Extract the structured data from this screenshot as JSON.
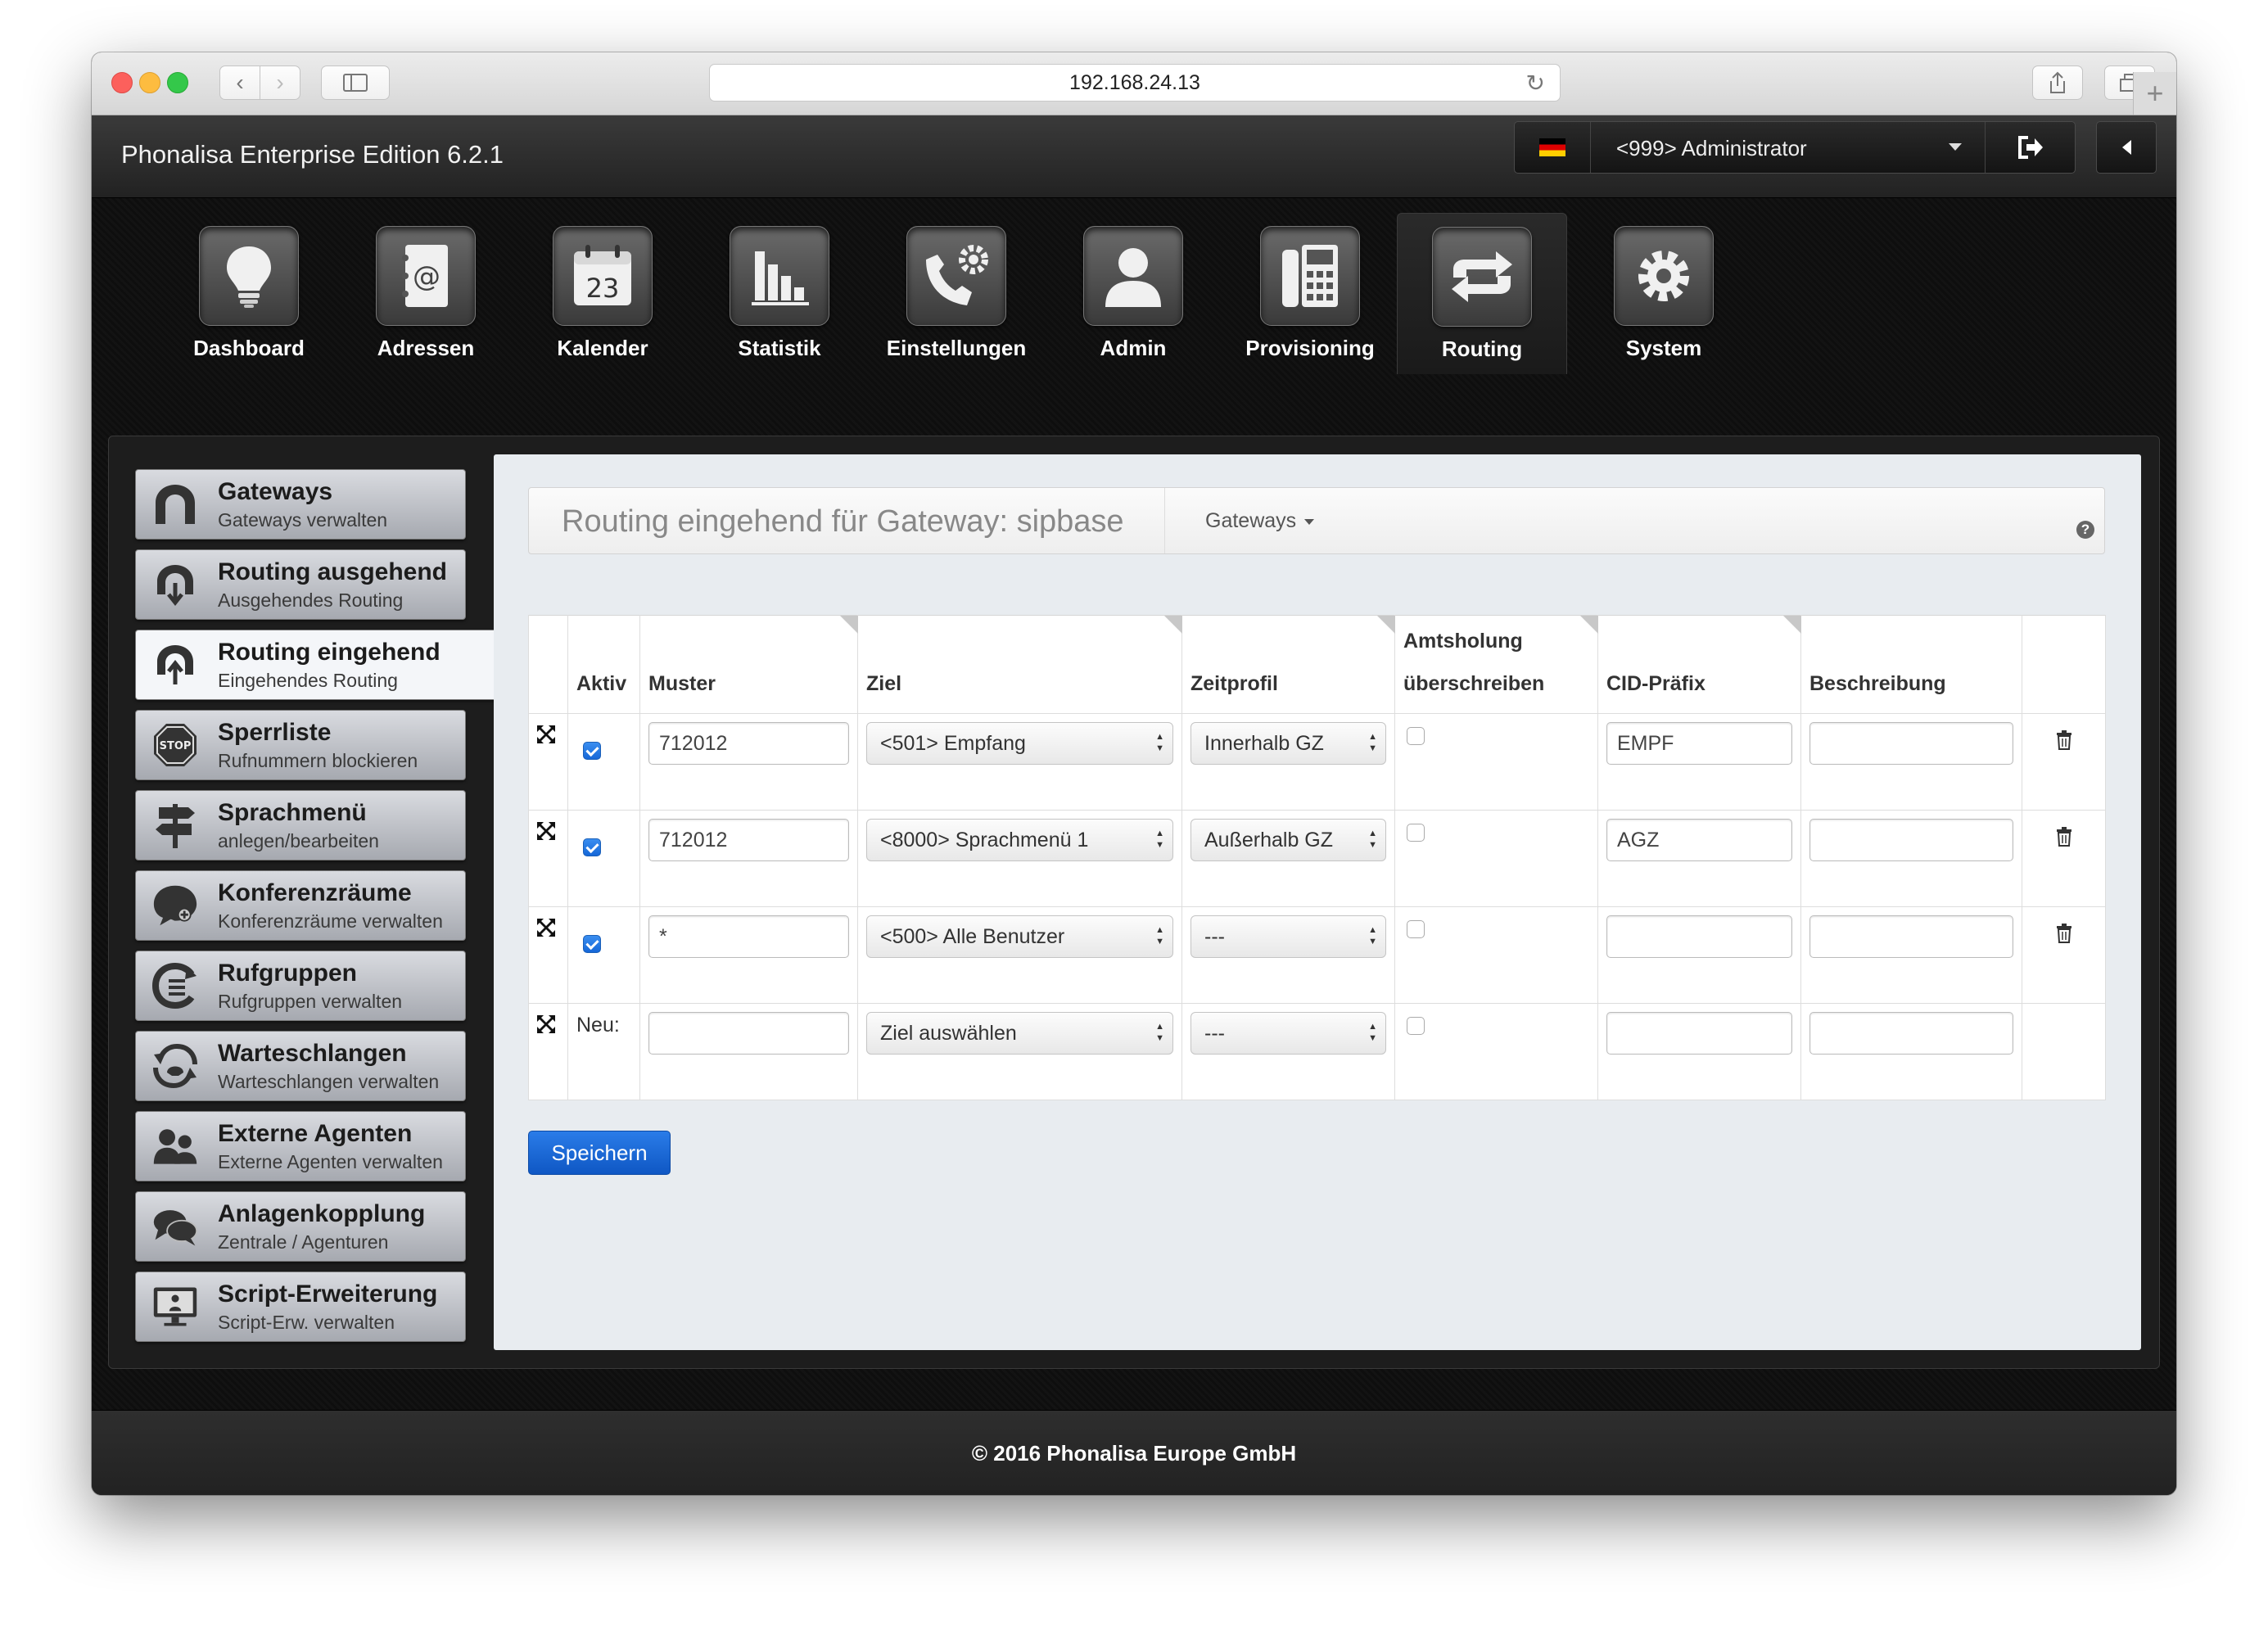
{
  "browser": {
    "url": "192.168.24.13"
  },
  "app": {
    "title": "Phonalisa Enterprise Edition 6.2.1",
    "user": "<999> Administrator",
    "footer": "© 2016 Phonalisa Europe GmbH"
  },
  "nav": [
    {
      "label": "Dashboard",
      "icon": "lightbulb-icon"
    },
    {
      "label": "Adressen",
      "icon": "address-book-icon"
    },
    {
      "label": "Kalender",
      "icon": "calendar-icon",
      "day": "23"
    },
    {
      "label": "Statistik",
      "icon": "bar-chart-icon"
    },
    {
      "label": "Einstellungen",
      "icon": "phone-settings-icon"
    },
    {
      "label": "Admin",
      "icon": "user-icon"
    },
    {
      "label": "Provisioning",
      "icon": "desk-phone-icon"
    },
    {
      "label": "Routing",
      "icon": "routing-arrows-icon",
      "active": true
    },
    {
      "label": "System",
      "icon": "gear-icon"
    }
  ],
  "sidebar": [
    {
      "title": "Gateways",
      "sub": "Gateways verwalten",
      "icon": "gateway-icon"
    },
    {
      "title": "Routing ausgehend",
      "sub": "Ausgehendes Routing",
      "icon": "gateway-out-icon"
    },
    {
      "title": "Routing eingehend",
      "sub": "Eingehendes Routing",
      "icon": "gateway-in-icon",
      "active": true
    },
    {
      "title": "Sperrliste",
      "sub": "Rufnummern blockieren",
      "icon": "stop-sign-icon",
      "icon_text": "STOP"
    },
    {
      "title": "Sprachmenü",
      "sub": "anlegen/bearbeiten",
      "icon": "signpost-icon"
    },
    {
      "title": "Konferenzräume",
      "sub": "Konferenzräume verwalten",
      "icon": "conference-icon"
    },
    {
      "title": "Rufgruppen",
      "sub": "Rufgruppen verwalten",
      "icon": "ring-group-icon"
    },
    {
      "title": "Warteschlangen",
      "sub": "Warteschlangen verwalten",
      "icon": "queue-icon"
    },
    {
      "title": "Externe Agenten",
      "sub": "Externe Agenten verwalten",
      "icon": "agents-icon"
    },
    {
      "title": "Anlagenkopplung",
      "sub": "Zentrale / Agenturen",
      "icon": "chat-bubbles-icon"
    },
    {
      "title": "Script-Erweiterung",
      "sub": "Script-Erw. verwalten",
      "icon": "script-monitor-icon"
    }
  ],
  "main": {
    "title": "Routing eingehend für Gateway: sipbase",
    "gateways_dropdown": "Gateways",
    "help": "?",
    "columns": {
      "aktiv": "Aktiv",
      "muster": "Muster",
      "ziel": "Ziel",
      "zeitprofil": "Zeitprofil",
      "amts1": "Amtsholung",
      "amts2": "überschreiben",
      "cid": "CID-Präfix",
      "beschreibung": "Beschreibung"
    },
    "rows": [
      {
        "aktiv": true,
        "muster": "712012",
        "ziel": "<501> Empfang",
        "zeitprofil": "Innerhalb GZ",
        "amts": false,
        "cid": "EMPF",
        "beschreibung": ""
      },
      {
        "aktiv": true,
        "muster": "712012",
        "ziel": "<8000> Sprachmenü 1",
        "zeitprofil": "Außerhalb GZ",
        "amts": false,
        "cid": "AGZ",
        "beschreibung": ""
      },
      {
        "aktiv": true,
        "muster": "*",
        "ziel": "<500> Alle Benutzer",
        "zeitprofil": "---",
        "amts": false,
        "cid": "",
        "beschreibung": ""
      }
    ],
    "new_row": {
      "label": "Neu:",
      "muster": "",
      "ziel": "Ziel auswählen",
      "zeitprofil": "---",
      "cid": "",
      "beschreibung": ""
    },
    "save_label": "Speichern"
  },
  "colors": {
    "accent": "#1567d8",
    "header_bg": "#2a2a2a",
    "content_bg": "#e8ecf0"
  }
}
